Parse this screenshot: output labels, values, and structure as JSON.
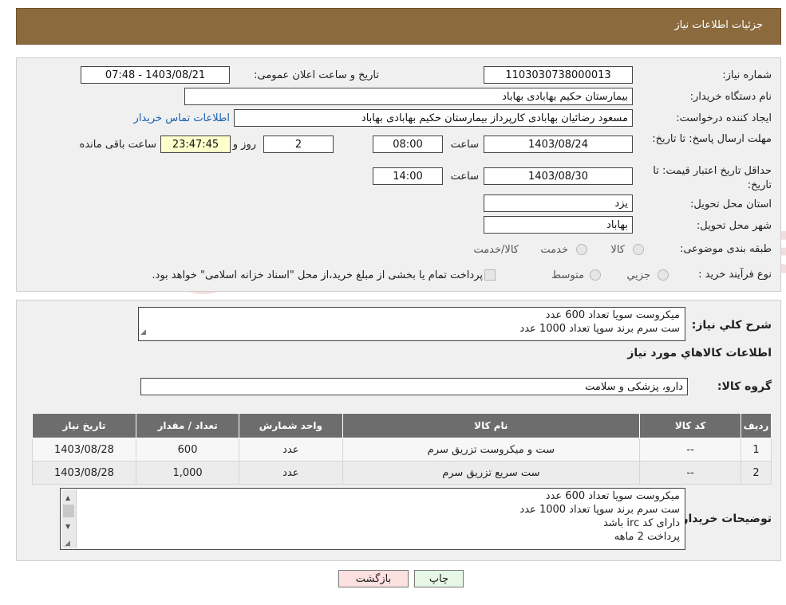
{
  "header": {
    "title": "جزئیات اطلاعات نیاز"
  },
  "details": {
    "need_number_label": "شماره نیاز:",
    "need_number": "1103030738000013",
    "announce_label": "تاریخ و ساعت اعلان عمومی:",
    "announce_value": "1403/08/21 - 07:48",
    "buyer_org_label": "نام دستگاه خریدار:",
    "buyer_org": "بیمارستان حکیم بهابادی بهاباد",
    "creator_label": "ایجاد کننده درخواست:",
    "creator": "مسعود رضائیان بهابادی کارپرداز بیمارستان حکیم بهابادی بهاباد",
    "contact_link": "اطلاعات تماس خریدار",
    "deadline_label": "مهلت ارسال پاسخ: تا تاریخ:",
    "deadline_date": "1403/08/24",
    "time_label": "ساعت",
    "deadline_time": "08:00",
    "days_value": "2",
    "days_label": "روز و",
    "remaining_time": "23:47:45",
    "remaining_label": "ساعت باقی مانده",
    "validity_label": "حداقل تاریخ اعتبار قیمت: تا تاریخ:",
    "validity_date": "1403/08/30",
    "validity_time_label": "ساعت",
    "validity_time": "14:00",
    "province_label": "استان محل تحویل:",
    "province": "یزد",
    "city_label": "شهر محل تحویل:",
    "city": "بهاباد",
    "category_label": "طبقه بندی موضوعی:",
    "category_options": [
      "کالا",
      "خدمت",
      "کالا/خدمت"
    ],
    "process_label": "نوع فرآیند خرید :",
    "process_options": [
      "جزیي",
      "متوسط"
    ],
    "process_note": "پرداخت تمام یا بخشی از مبلغ خرید،از محل \"اسناد خزانه اسلامی\" خواهد بود."
  },
  "summary": {
    "desc_label": "شرح کلي نياز:",
    "desc_lines": [
      "میکروست سویا تعداد 600 عدد",
      "ست سرم برند سوپا تعداد 1000  عدد"
    ],
    "items_title": "اطلاعات کالاهاي مورد نياز",
    "group_label": "گروه کالا:",
    "group_value": "دارو، پزشکی و سلامت"
  },
  "table": {
    "headers": [
      "رديف",
      "کد کالا",
      "نام کالا",
      "واحد شمارش",
      "تعداد / مقدار",
      "تاریخ نیاز"
    ],
    "rows": [
      [
        "1",
        "--",
        "ست و میکروست تزریق سرم",
        "عدد",
        "600",
        "1403/08/28"
      ],
      [
        "2",
        "--",
        "ست سریع تزریق سرم",
        "عدد",
        "1,000",
        "1403/08/28"
      ]
    ]
  },
  "buyer_notes": {
    "label": "توضیحات خریدار:",
    "lines": [
      "میکروست سویا تعداد 600 عدد",
      "ست سرم برند سوپا تعداد 1000  عدد",
      "دارای کد irc باشد",
      "پرداخت 2 ماهه"
    ]
  },
  "buttons": {
    "print": "چاپ",
    "back": "بازگشت"
  },
  "watermark": {
    "text": "AriaTender.neT"
  },
  "colors": {
    "header_bg": "#8b6a3e",
    "link": "#1a5fb4",
    "back_bg": "#fde0e0",
    "print_bg": "#e6f7e6"
  }
}
